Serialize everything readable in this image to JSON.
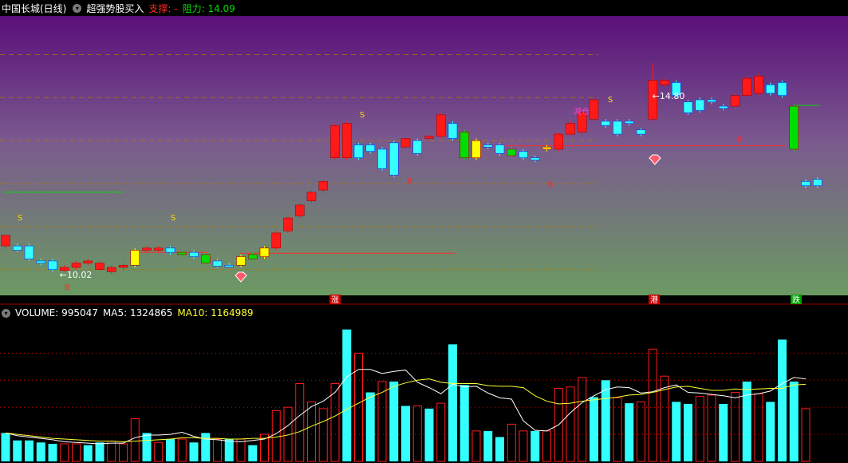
{
  "header": {
    "title": "中国长城(日线)",
    "indicator": "超强势股买入",
    "support_label": "支撑: -",
    "resistance_label": "阻力: 14.09",
    "dropdown_icon": "chevron-down-icon"
  },
  "volume_header": {
    "volume": "VOLUME: 995047",
    "ma5": "MA5: 1324865",
    "ma10": "MA10: 1164989"
  },
  "colors": {
    "up": "#ff1a1a",
    "down": "#33ffff",
    "bull": "#00dd00",
    "neutral": "#ffff00",
    "grid": "#b07800",
    "support": "#ff2a2a",
    "resistance": "#00dd00",
    "ma5": "#ffffff",
    "ma10": "#ffff33",
    "bg_top": "#5a0f7a",
    "bg_bottom": "#6b9a62"
  },
  "price_chart": {
    "annotations": [
      {
        "text": "S",
        "color": "#ffdd00"
      },
      {
        "text": "S",
        "color": "#ffdd00"
      },
      {
        "text": "S",
        "color": "#ffdd00"
      },
      {
        "text": "S",
        "color": "#ffdd00"
      },
      {
        "text": "B",
        "color": "#ff2a2a"
      },
      {
        "text": "B",
        "color": "#ff2a2a"
      },
      {
        "text": "B",
        "color": "#ff2a2a"
      },
      {
        "text": "B",
        "color": "#ff2a2a"
      },
      {
        "text": "B",
        "color": "#ff2a2a"
      },
      {
        "text": "减仓",
        "color": "#ff3ccf"
      },
      {
        "text": "←10.02",
        "color": "#ffffff"
      },
      {
        "text": "←14.80",
        "color": "#ffffff"
      }
    ],
    "event_markers": [
      {
        "text": "涨",
        "bg": "#cc0000"
      },
      {
        "text": "港",
        "bg": "#cc0000"
      },
      {
        "text": "跌",
        "bg": "#00a000"
      }
    ]
  },
  "chart_data": [
    {
      "type": "candlestick",
      "title": "中国长城(日线)",
      "candles": [
        {
          "o": 10.55,
          "c": 10.8,
          "h": 10.8,
          "l": 10.5,
          "t": "up"
        },
        {
          "o": 10.55,
          "c": 10.45,
          "h": 10.6,
          "l": 10.4,
          "t": "down"
        },
        {
          "o": 10.55,
          "c": 10.25,
          "h": 10.6,
          "l": 10.2,
          "t": "down"
        },
        {
          "o": 10.2,
          "c": 10.15,
          "h": 10.25,
          "l": 10.1,
          "t": "down"
        },
        {
          "o": 10.2,
          "c": 10.0,
          "h": 10.25,
          "l": 9.95,
          "t": "down"
        },
        {
          "o": 9.98,
          "c": 10.05,
          "h": 10.1,
          "l": 9.95,
          "t": "up"
        },
        {
          "o": 10.05,
          "c": 10.15,
          "h": 10.2,
          "l": 10.0,
          "t": "up"
        },
        {
          "o": 10.15,
          "c": 10.2,
          "h": 10.25,
          "l": 10.1,
          "t": "up"
        },
        {
          "o": 10.0,
          "c": 10.15,
          "h": 10.2,
          "l": 9.98,
          "t": "up"
        },
        {
          "o": 9.95,
          "c": 10.05,
          "h": 10.1,
          "l": 9.9,
          "t": "up"
        },
        {
          "o": 10.05,
          "c": 10.1,
          "h": 10.15,
          "l": 10.0,
          "t": "up"
        },
        {
          "o": 10.1,
          "c": 10.45,
          "h": 10.5,
          "l": 10.05,
          "t": "neutral"
        },
        {
          "o": 10.45,
          "c": 10.5,
          "h": 10.55,
          "l": 10.4,
          "t": "up"
        },
        {
          "o": 10.45,
          "c": 10.5,
          "h": 10.55,
          "l": 10.4,
          "t": "up"
        },
        {
          "o": 10.5,
          "c": 10.4,
          "h": 10.55,
          "l": 10.35,
          "t": "down"
        },
        {
          "o": 10.4,
          "c": 10.35,
          "h": 10.45,
          "l": 10.3,
          "t": "bull"
        },
        {
          "o": 10.4,
          "c": 10.3,
          "h": 10.45,
          "l": 10.25,
          "t": "down"
        },
        {
          "o": 10.35,
          "c": 10.15,
          "h": 10.4,
          "l": 10.1,
          "t": "bull"
        },
        {
          "o": 10.2,
          "c": 10.08,
          "h": 10.25,
          "l": 10.05,
          "t": "down"
        },
        {
          "o": 10.1,
          "c": 10.07,
          "h": 10.15,
          "l": 10.05,
          "t": "down"
        },
        {
          "o": 10.1,
          "c": 10.3,
          "h": 10.35,
          "l": 10.05,
          "t": "neutral"
        },
        {
          "o": 10.25,
          "c": 10.35,
          "h": 10.4,
          "l": 10.2,
          "t": "bull"
        },
        {
          "o": 10.3,
          "c": 10.5,
          "h": 10.55,
          "l": 10.25,
          "t": "neutral"
        },
        {
          "o": 10.5,
          "c": 10.85,
          "h": 10.9,
          "l": 10.45,
          "t": "up"
        },
        {
          "o": 10.9,
          "c": 11.2,
          "h": 11.25,
          "l": 10.85,
          "t": "up"
        },
        {
          "o": 11.25,
          "c": 11.5,
          "h": 11.55,
          "l": 11.2,
          "t": "up"
        },
        {
          "o": 11.6,
          "c": 11.8,
          "h": 11.85,
          "l": 11.55,
          "t": "up"
        },
        {
          "o": 11.85,
          "c": 12.05,
          "h": 12.1,
          "l": 11.8,
          "t": "up"
        },
        {
          "o": 12.6,
          "c": 13.35,
          "h": 13.4,
          "l": 12.55,
          "t": "up"
        },
        {
          "o": 12.6,
          "c": 13.4,
          "h": 13.45,
          "l": 12.55,
          "t": "up"
        },
        {
          "o": 12.9,
          "c": 12.6,
          "h": 12.95,
          "l": 12.55,
          "t": "down"
        },
        {
          "o": 12.9,
          "c": 12.75,
          "h": 12.95,
          "l": 12.7,
          "t": "down"
        },
        {
          "o": 12.8,
          "c": 12.35,
          "h": 12.85,
          "l": 12.3,
          "t": "down"
        },
        {
          "o": 12.95,
          "c": 12.2,
          "h": 13.0,
          "l": 12.15,
          "t": "down"
        },
        {
          "o": 12.85,
          "c": 13.05,
          "h": 13.1,
          "l": 12.8,
          "t": "up"
        },
        {
          "o": 13.0,
          "c": 12.7,
          "h": 13.05,
          "l": 12.65,
          "t": "down"
        },
        {
          "o": 13.05,
          "c": 13.1,
          "h": 13.15,
          "l": 13.0,
          "t": "up"
        },
        {
          "o": 13.1,
          "c": 13.6,
          "h": 13.65,
          "l": 13.05,
          "t": "up"
        },
        {
          "o": 13.4,
          "c": 13.05,
          "h": 13.45,
          "l": 13.0,
          "t": "down"
        },
        {
          "o": 13.2,
          "c": 12.6,
          "h": 13.25,
          "l": 12.55,
          "t": "bull"
        },
        {
          "o": 13.0,
          "c": 12.6,
          "h": 13.05,
          "l": 12.55,
          "t": "neutral"
        },
        {
          "o": 12.9,
          "c": 12.85,
          "h": 12.95,
          "l": 12.8,
          "t": "down"
        },
        {
          "o": 12.9,
          "c": 12.7,
          "h": 12.95,
          "l": 12.65,
          "t": "down"
        },
        {
          "o": 12.8,
          "c": 12.65,
          "h": 12.85,
          "l": 12.6,
          "t": "bull"
        },
        {
          "o": 12.75,
          "c": 12.6,
          "h": 12.8,
          "l": 12.55,
          "t": "down"
        },
        {
          "o": 12.6,
          "c": 12.55,
          "h": 12.65,
          "l": 12.5,
          "t": "down"
        },
        {
          "o": 12.8,
          "c": 12.85,
          "h": 12.9,
          "l": 12.75,
          "t": "neutral"
        },
        {
          "o": 12.8,
          "c": 13.15,
          "h": 13.2,
          "l": 12.75,
          "t": "up"
        },
        {
          "o": 13.15,
          "c": 13.4,
          "h": 13.45,
          "l": 13.1,
          "t": "up"
        },
        {
          "o": 13.2,
          "c": 13.65,
          "h": 13.7,
          "l": 13.15,
          "t": "up"
        },
        {
          "o": 13.5,
          "c": 13.95,
          "h": 14.0,
          "l": 13.45,
          "t": "up"
        },
        {
          "o": 13.45,
          "c": 13.35,
          "h": 13.5,
          "l": 13.3,
          "t": "down"
        },
        {
          "o": 13.45,
          "c": 13.15,
          "h": 13.5,
          "l": 13.1,
          "t": "down"
        },
        {
          "o": 13.45,
          "c": 13.4,
          "h": 13.5,
          "l": 13.35,
          "t": "down"
        },
        {
          "o": 13.25,
          "c": 13.15,
          "h": 13.3,
          "l": 13.1,
          "t": "down"
        },
        {
          "o": 13.5,
          "c": 14.4,
          "h": 14.8,
          "l": 13.45,
          "t": "up"
        },
        {
          "o": 14.3,
          "c": 14.4,
          "h": 14.45,
          "l": 14.25,
          "t": "up"
        },
        {
          "o": 14.35,
          "c": 14.05,
          "h": 14.4,
          "l": 14.0,
          "t": "down"
        },
        {
          "o": 13.9,
          "c": 13.65,
          "h": 13.95,
          "l": 13.6,
          "t": "down"
        },
        {
          "o": 13.95,
          "c": 13.7,
          "h": 14.0,
          "l": 13.65,
          "t": "down"
        },
        {
          "o": 13.95,
          "c": 13.9,
          "h": 14.0,
          "l": 13.85,
          "t": "down"
        },
        {
          "o": 13.8,
          "c": 13.75,
          "h": 13.85,
          "l": 13.7,
          "t": "down"
        },
        {
          "o": 13.8,
          "c": 14.05,
          "h": 14.1,
          "l": 13.75,
          "t": "up"
        },
        {
          "o": 14.05,
          "c": 14.45,
          "h": 14.5,
          "l": 14.0,
          "t": "up"
        },
        {
          "o": 14.1,
          "c": 14.5,
          "h": 14.55,
          "l": 14.05,
          "t": "up"
        },
        {
          "o": 14.3,
          "c": 14.1,
          "h": 14.35,
          "l": 14.05,
          "t": "down"
        },
        {
          "o": 14.35,
          "c": 14.05,
          "h": 14.4,
          "l": 14.0,
          "t": "down"
        },
        {
          "o": 13.8,
          "c": 12.8,
          "h": 13.85,
          "l": 12.75,
          "t": "bull"
        },
        {
          "o": 12.05,
          "c": 11.95,
          "h": 12.1,
          "l": 11.9,
          "t": "down"
        },
        {
          "o": 12.1,
          "c": 11.95,
          "h": 12.15,
          "l": 11.9,
          "t": "down"
        }
      ]
    },
    {
      "type": "bar",
      "title": "VOLUME",
      "series": [
        {
          "name": "VOLUME",
          "values": [
            {
              "v": 42,
              "t": "down"
            },
            {
              "v": 31,
              "t": "down"
            },
            {
              "v": 31,
              "t": "down"
            },
            {
              "v": 28,
              "t": "down"
            },
            {
              "v": 26,
              "t": "down"
            },
            {
              "v": 26,
              "t": "up"
            },
            {
              "v": 26,
              "t": "up"
            },
            {
              "v": 24,
              "t": "down"
            },
            {
              "v": 28,
              "t": "down"
            },
            {
              "v": 30,
              "t": "up"
            },
            {
              "v": 26,
              "t": "up"
            },
            {
              "v": 63,
              "t": "up"
            },
            {
              "v": 42,
              "t": "down"
            },
            {
              "v": 28,
              "t": "up"
            },
            {
              "v": 33,
              "t": "down"
            },
            {
              "v": 33,
              "t": "up"
            },
            {
              "v": 28,
              "t": "down"
            },
            {
              "v": 42,
              "t": "down"
            },
            {
              "v": 33,
              "t": "up"
            },
            {
              "v": 33,
              "t": "down"
            },
            {
              "v": 33,
              "t": "up"
            },
            {
              "v": 24,
              "t": "down"
            },
            {
              "v": 40,
              "t": "up"
            },
            {
              "v": 75,
              "t": "up"
            },
            {
              "v": 80,
              "t": "up"
            },
            {
              "v": 115,
              "t": "up"
            },
            {
              "v": 88,
              "t": "up"
            },
            {
              "v": 78,
              "t": "up"
            },
            {
              "v": 115,
              "t": "up"
            },
            {
              "v": 195,
              "t": "down"
            },
            {
              "v": 160,
              "t": "up"
            },
            {
              "v": 102,
              "t": "down"
            },
            {
              "v": 118,
              "t": "up"
            },
            {
              "v": 118,
              "t": "down"
            },
            {
              "v": 82,
              "t": "down"
            },
            {
              "v": 82,
              "t": "up"
            },
            {
              "v": 78,
              "t": "down"
            },
            {
              "v": 86,
              "t": "up"
            },
            {
              "v": 173,
              "t": "down"
            },
            {
              "v": 113,
              "t": "down"
            },
            {
              "v": 45,
              "t": "up"
            },
            {
              "v": 45,
              "t": "down"
            },
            {
              "v": 36,
              "t": "down"
            },
            {
              "v": 55,
              "t": "up"
            },
            {
              "v": 45,
              "t": "up"
            },
            {
              "v": 45,
              "t": "down"
            },
            {
              "v": 45,
              "t": "up"
            },
            {
              "v": 108,
              "t": "up"
            },
            {
              "v": 110,
              "t": "up"
            },
            {
              "v": 124,
              "t": "up"
            },
            {
              "v": 95,
              "t": "down"
            },
            {
              "v": 120,
              "t": "down"
            },
            {
              "v": 94,
              "t": "up"
            },
            {
              "v": 86,
              "t": "down"
            },
            {
              "v": 88,
              "t": "up"
            },
            {
              "v": 166,
              "t": "up"
            },
            {
              "v": 126,
              "t": "up"
            },
            {
              "v": 88,
              "t": "down"
            },
            {
              "v": 85,
              "t": "down"
            },
            {
              "v": 96,
              "t": "up"
            },
            {
              "v": 98,
              "t": "up"
            },
            {
              "v": 85,
              "t": "down"
            },
            {
              "v": 102,
              "t": "up"
            },
            {
              "v": 118,
              "t": "down"
            },
            {
              "v": 100,
              "t": "up"
            },
            {
              "v": 88,
              "t": "down"
            },
            {
              "v": 180,
              "t": "down"
            },
            {
              "v": 118,
              "t": "down"
            },
            {
              "v": 78,
              "t": "up"
            }
          ]
        }
      ],
      "ma5": {
        "name": "MA5",
        "values": [
          42,
          38,
          36,
          34,
          32,
          29,
          28,
          27,
          26,
          27,
          27,
          35,
          39,
          39,
          40,
          43,
          37,
          33,
          32,
          30,
          29,
          31,
          33,
          41,
          53,
          68,
          81,
          89,
          102,
          125,
          136,
          136,
          130,
          133,
          135,
          117,
          109,
          100,
          114,
          110,
          111,
          101,
          94,
          92,
          60,
          46,
          45,
          54,
          72,
          87,
          97,
          106,
          110,
          109,
          101,
          103,
          109,
          113,
          102,
          101,
          99,
          97,
          94,
          98,
          100,
          104,
          115,
          124,
          122
        ]
      },
      "ma10": {
        "name": "MA10",
        "values": [
          42,
          40,
          38,
          36,
          34,
          33,
          32,
          31,
          30,
          30,
          29,
          30,
          31,
          32,
          33,
          35,
          35,
          34,
          34,
          33,
          33,
          34,
          34,
          36,
          39,
          44,
          52,
          59,
          67,
          77,
          86,
          95,
          102,
          111,
          116,
          120,
          122,
          117,
          115,
          115,
          115,
          112,
          111,
          111,
          109,
          97,
          89,
          85,
          86,
          89,
          91,
          93,
          95,
          98,
          99,
          102,
          106,
          110,
          111,
          108,
          105,
          105,
          107,
          106,
          107,
          108,
          108,
          113,
          114
        ]
      }
    }
  ]
}
